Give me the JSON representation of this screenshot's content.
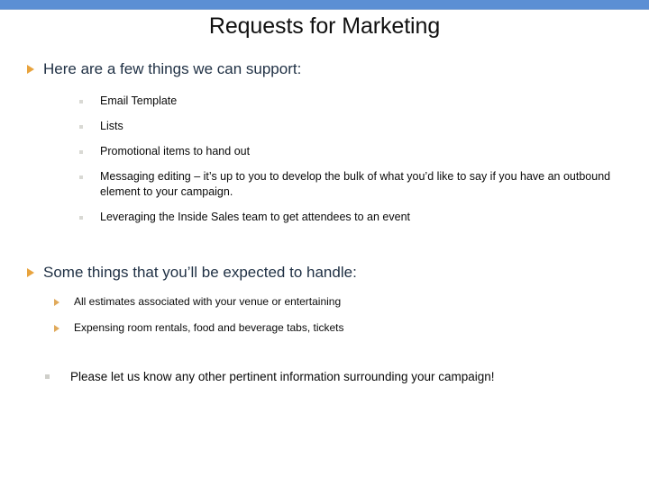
{
  "theme": {
    "band_color": "#5B8FD4",
    "title_color": "#101010",
    "level1_text_color": "#1F3044",
    "level2_text_color": "#0A0A0A",
    "triangle_bullet_color": "#E8A33D",
    "square_bullet_color": "#D9D9D4"
  },
  "slide": {
    "title": "Requests for Marketing",
    "sections": [
      {
        "heading": "Here are a few things we can support:",
        "bullet_icon": "triangle-bullet-icon",
        "items": [
          {
            "text": "Email Template",
            "bullet_icon": "square-bullet-icon"
          },
          {
            "text": "Lists",
            "bullet_icon": "square-bullet-icon"
          },
          {
            "text": "Promotional items to hand out",
            "bullet_icon": "square-bullet-icon"
          },
          {
            "text": "Messaging editing – it’s up to you to develop the bulk of what you’d like to say if you have an outbound element to your campaign.",
            "bullet_icon": "square-bullet-icon"
          },
          {
            "text": "Leveraging the Inside Sales team to get attendees to an event",
            "bullet_icon": "square-bullet-icon"
          }
        ]
      },
      {
        "heading": "Some things that you’ll be expected to handle:",
        "bullet_icon": "triangle-bullet-icon",
        "items": [
          {
            "text": "All estimates associated with your venue or entertaining",
            "bullet_icon": "triangle-bullet-icon"
          },
          {
            "text": "Expensing room rentals, food and beverage tabs, tickets",
            "bullet_icon": "triangle-bullet-icon"
          }
        ]
      }
    ],
    "closing_note": {
      "text": "Please let us know any other pertinent information surrounding your campaign!",
      "bullet_icon": "square-bullet-icon"
    }
  }
}
